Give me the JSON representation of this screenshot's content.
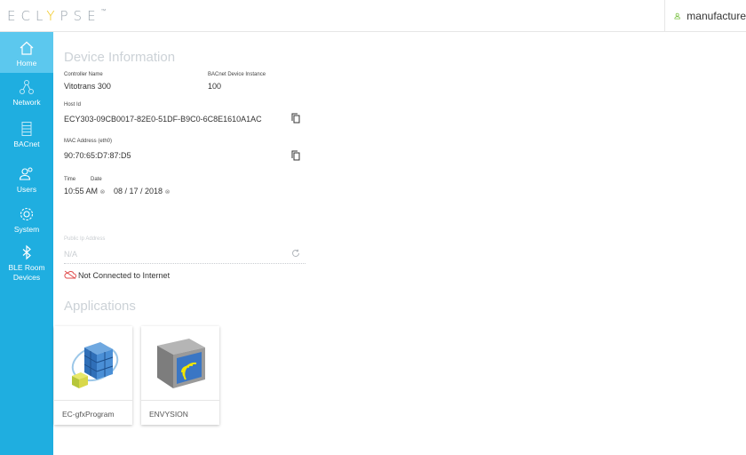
{
  "header": {
    "logo_text": "ECLYPSE",
    "logo_mark": "™",
    "user_name": "manufacture",
    "accent_color": "#7ac143"
  },
  "sidebar": {
    "bg_color": "#1faee0",
    "items": [
      {
        "label": "Home",
        "icon": "home-icon"
      },
      {
        "label": "Network",
        "icon": "network-icon"
      },
      {
        "label": "BACnet",
        "icon": "bacnet-icon"
      },
      {
        "label": "Users",
        "icon": "users-icon"
      },
      {
        "label": "System",
        "icon": "gear-icon"
      },
      {
        "label": "BLE Room",
        "label2": "Devices",
        "icon": "bluetooth-icon"
      }
    ]
  },
  "device_info": {
    "title": "Device Information",
    "controller_name_label": "Controller Name",
    "controller_name": "Vitotrans 300",
    "bacnet_instance_label": "BACnet Device Instance",
    "bacnet_instance": "100",
    "host_id_label": "Host Id",
    "host_id": "ECY303-09CB0017-82E0-51DF-B9C0-6C8E1610A1AC",
    "mac_label": "MAC Address (eth0)",
    "mac": "90:70:65:D7:87:D5",
    "time_label": "Time",
    "time_value": "10:55  AM",
    "date_label": "Date",
    "date_value": "08 / 17 / 2018",
    "public_ip_label": "Public Ip Address",
    "public_ip": "N/A",
    "internet_status": "Not Connected to Internet"
  },
  "applications": {
    "title": "Applications",
    "items": [
      {
        "label": "EC-gfxProgram"
      },
      {
        "label": "ENVYSION"
      }
    ]
  }
}
